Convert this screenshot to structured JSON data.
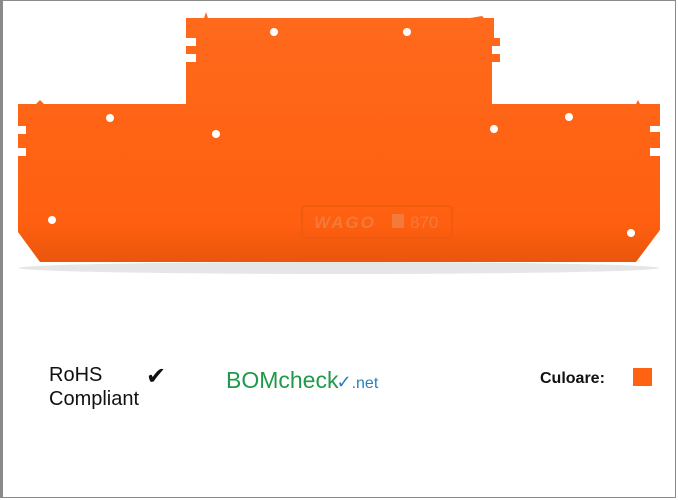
{
  "product": {
    "image_name": "end-and-intermediate-plate",
    "brand_mark": "WAGO",
    "series_mark": "870",
    "plate_color": "#ff6211",
    "hole_color": "#ffffff"
  },
  "rohs": {
    "line1": "RoHS",
    "line2": "Compliant",
    "check_glyph": "✔"
  },
  "bomcheck": {
    "bom": "BOM",
    "check": "check",
    "tick": "✓",
    "net": ".net"
  },
  "color_info": {
    "label": "Culoare:",
    "swatch_color": "#ff6211"
  }
}
